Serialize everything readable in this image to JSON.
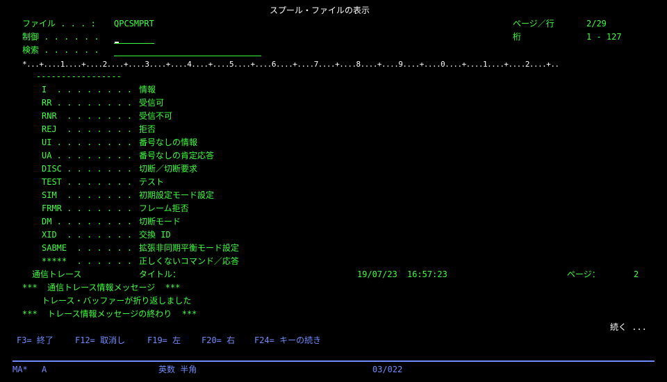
{
  "header": {
    "title": "スプール・ファイルの表示",
    "file_label": "ファイル . . . :",
    "file_value": "QPCSMPRT",
    "control_label": "制御 . . . . . .",
    "search_label": "検索 . . . . . .",
    "page_row_label": "ページ／行",
    "page_row_value": "2/29",
    "column_label": "桁",
    "column_value": "1 - 127"
  },
  "ruler": "*...+....1....+....2....+....3....+....4....+....5....+....6....+....7....+....8....+....9....+....0....+....1....+....2....+..",
  "spool": {
    "dash_line": "-----------------",
    "entries": [
      {
        "code": "I  . . . . . . . .",
        "desc": "情報"
      },
      {
        "code": "RR . . . . . . . .",
        "desc": "受信可"
      },
      {
        "code": "RNR  . . . . . . .",
        "desc": "受信不可"
      },
      {
        "code": "REJ  . . . . . . .",
        "desc": "拒否"
      },
      {
        "code": "UI . . . . . . . .",
        "desc": "番号なしの情報"
      },
      {
        "code": "UA . . . . . . . .",
        "desc": "番号なしの肯定応答"
      },
      {
        "code": "DISC . . . . . . .",
        "desc": "切断／切断要求"
      },
      {
        "code": "TEST . . . . . . .",
        "desc": "テスト"
      },
      {
        "code": "SIM  . . . . . . .",
        "desc": "初期設定モード設定"
      },
      {
        "code": "FRMR . . . . . . .",
        "desc": "フレーム拒否"
      },
      {
        "code": "DM . . . . . . . .",
        "desc": "切断モード"
      },
      {
        "code": "XID  . . . . . . .",
        "desc": "交換 ID"
      },
      {
        "code": "SABME  . . . . . .",
        "desc": "拡張非同期平衡モード設定"
      },
      {
        "code": "*****  . . . . . .",
        "desc": "正しくないコマンド／応答"
      }
    ],
    "trace_label": "通信トレース",
    "title_label": "タイトル：",
    "date": "19/07/23",
    "time": "16:57:23",
    "page_label": "ページ：",
    "page_value": "2",
    "msg_line1": "***  通信トレース情報メッセージ  ***",
    "msg_line2": "トレース・バッファーが折り返しました",
    "msg_line3": "***  トレース情報メッセージの終わり  ***"
  },
  "more": "続く ...",
  "fkeys": {
    "f3": "F3= 終了",
    "f12": "F12= 取消し",
    "f19": "F19= 左",
    "f20": "F20= 右",
    "f24": "F24= キーの続き"
  },
  "status": {
    "session": "MA*",
    "mode": "A",
    "input_mode": "英数 半角",
    "cursor_pos": "03/022"
  },
  "colors": {
    "background": "#000000",
    "text_green": "#3cff3c",
    "text_white": "#ffffff",
    "text_blue": "#6f8cff"
  }
}
